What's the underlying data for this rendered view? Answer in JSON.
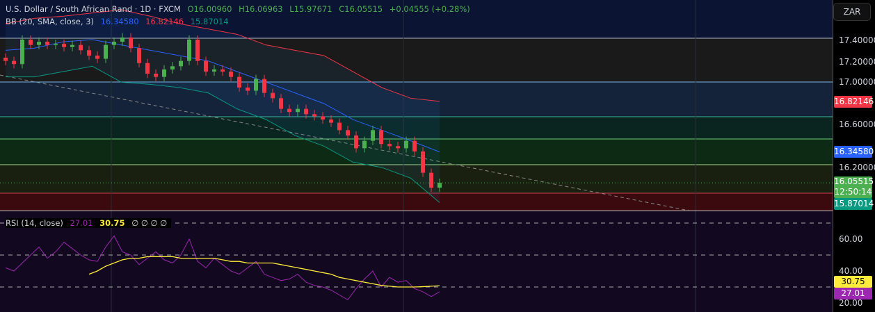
{
  "header": {
    "symbol": "U.S. Dollar / South African Rand · 1D · FXCM",
    "open": "O16.00960",
    "high": "H16.06963",
    "low": "L15.97671",
    "close": "C16.05515",
    "change": "+0.04555 (+0.28%)"
  },
  "bb_legend": {
    "label": "BB (20, SMA, close, 3)",
    "basis": "16.34580",
    "upper": "16.82146",
    "lower": "15.87014"
  },
  "rsi_legend": {
    "label": "RSI (14, close)",
    "rsi": "27.01",
    "ma": "30.75",
    "extra": "∅ ∅ ∅ ∅"
  },
  "currency_button": "ZAR",
  "price_axis": [
    "17.40000",
    "17.20000",
    "17.00000",
    "16.60000",
    "16.20000"
  ],
  "price_tags": {
    "upper": "16.82146",
    "basis": "16.34580",
    "last": "16.05515",
    "countdown": "12:50:14",
    "lower": "15.87014"
  },
  "rsi_axis": [
    "60.00",
    "40.00",
    "20.00"
  ],
  "rsi_tags": {
    "ma": "30.75",
    "rsi": "27.01"
  },
  "colors": {
    "up": "#4caf50",
    "down": "#f23645",
    "basis": "#2962ff",
    "upper": "#f23645",
    "lower": "#089981",
    "rsi": "#9c27b0",
    "rsi_ma": "#ffeb3b"
  },
  "chart_data": [
    {
      "type": "candlestick",
      "title": "U.S. Dollar / South African Rand · 1D · FXCM",
      "ylim": [
        15.8,
        17.7
      ],
      "close": [
        17.2,
        17.17,
        17.4,
        17.35,
        17.38,
        17.35,
        17.36,
        17.33,
        17.35,
        17.3,
        17.25,
        17.22,
        17.35,
        17.38,
        17.42,
        17.32,
        17.18,
        17.08,
        17.05,
        17.12,
        17.15,
        17.2,
        17.4,
        17.2,
        17.1,
        17.12,
        17.1,
        17.05,
        16.95,
        16.92,
        17.03,
        16.9,
        16.85,
        16.75,
        16.72,
        16.75,
        16.7,
        16.68,
        16.65,
        16.62,
        16.55,
        16.5,
        16.38,
        16.45,
        16.55,
        16.42,
        16.4,
        16.38,
        16.45,
        16.35,
        16.15,
        16.0096,
        16.05515
      ],
      "bb_upper": [
        17.55,
        17.6,
        17.62,
        17.65,
        17.68,
        17.62,
        17.55,
        17.5,
        17.45,
        17.35,
        17.3,
        17.25,
        17.1,
        16.95,
        16.85,
        16.82
      ],
      "bb_basis": [
        17.3,
        17.32,
        17.38,
        17.4,
        17.35,
        17.3,
        17.25,
        17.2,
        17.1,
        17.0,
        16.9,
        16.8,
        16.65,
        16.55,
        16.45,
        16.3458
      ],
      "bb_lower": [
        17.05,
        17.05,
        17.1,
        17.15,
        17.0,
        16.98,
        16.95,
        16.9,
        16.75,
        16.65,
        16.5,
        16.4,
        16.25,
        16.2,
        16.1,
        15.87014
      ]
    },
    {
      "type": "line",
      "title": "RSI (14, close)",
      "ylim": [
        15,
        75
      ],
      "rsi": [
        42,
        40,
        45,
        50,
        55,
        48,
        52,
        58,
        54,
        50,
        47,
        46,
        55,
        62,
        52,
        50,
        44,
        48,
        52,
        47,
        45,
        50,
        60,
        46,
        42,
        48,
        44,
        40,
        38,
        42,
        46,
        38,
        36,
        34,
        35,
        38,
        33,
        31,
        30,
        28,
        25,
        22,
        29,
        35,
        40,
        30,
        36,
        33,
        34,
        29,
        27,
        24,
        27.01
      ],
      "rsi_ma": [
        38,
        40,
        43,
        45,
        47,
        48,
        48,
        49,
        49,
        49,
        49,
        48,
        48,
        48,
        48,
        48,
        47,
        46,
        46,
        45,
        45,
        45,
        45,
        44,
        43,
        42,
        41,
        40,
        39,
        38,
        36,
        35,
        34,
        33,
        32,
        31,
        30.5,
        30,
        30,
        30,
        30.2,
        30.5,
        30.75
      ]
    }
  ]
}
